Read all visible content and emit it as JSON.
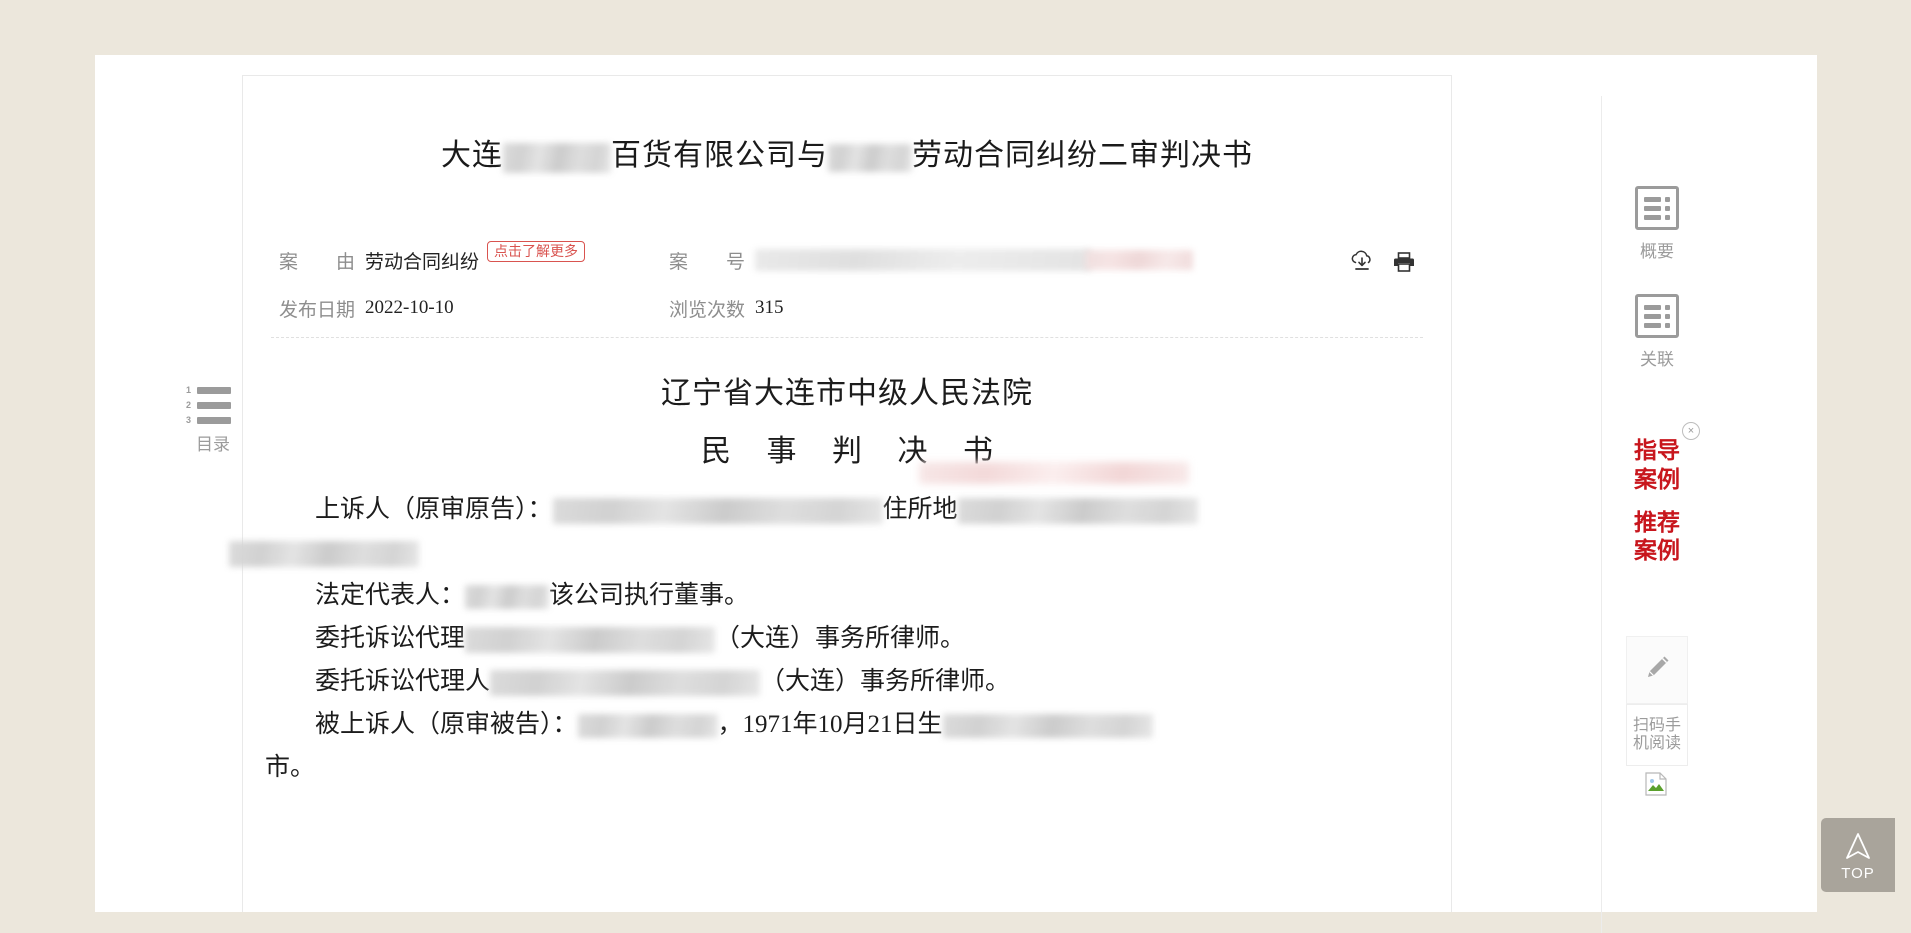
{
  "page": {
    "background_color": "#ece7dc",
    "panel_color": "#ffffff"
  },
  "document": {
    "title_prefix": "大连",
    "title_mid": "百货有限公司与",
    "title_suffix": "劳动合同纠纷二审判决书",
    "court_name": "辽宁省大连市中级人民法院",
    "doc_kind": "民 事 判 决 书"
  },
  "meta": {
    "case_cause_label": "案　　由",
    "case_cause_value": "劳动合同纠纷",
    "more_badge": "点击了解更多",
    "case_number_label": "案　　号",
    "case_number_value": "",
    "publish_date_label": "发布日期",
    "publish_date_value": "2022-10-10",
    "views_label": "浏览次数",
    "views_value": "315"
  },
  "actions": {
    "download_icon": "cloud-download-icon",
    "print_icon": "printer-icon"
  },
  "body_paragraphs": [
    {
      "id": "appellant",
      "lead": "上诉人（原审原告）：",
      "tail": "住所地",
      "redacted": true
    },
    {
      "id": "legal-rep",
      "lead": "法定代表人：",
      "tail": "该公司执行董事。",
      "redacted": true
    },
    {
      "id": "agent-1",
      "lead": "委托诉讼代理",
      "tail": "（大连）事务所律师。",
      "redacted": true
    },
    {
      "id": "agent-2",
      "lead": "委托诉讼代理人",
      "tail": "（大连）事务所律师。",
      "redacted": true
    },
    {
      "id": "appellee",
      "lead": "被上诉人（原审被告）：",
      "mid": "，1971年10月21日生",
      "tail": "市。",
      "redacted": true
    }
  ],
  "toc": {
    "label": "目录",
    "numbers": [
      "1",
      "2",
      "3"
    ],
    "icon": "numbered-list-icon"
  },
  "tools": [
    {
      "id": "summary",
      "label": "概要",
      "icon": "summary-document-icon"
    },
    {
      "id": "related",
      "label": "关联",
      "icon": "related-document-icon"
    }
  ],
  "promo": {
    "close_label": "×",
    "items": [
      {
        "id": "guiding-case",
        "line1": "指导",
        "line2": "案例",
        "color": "#c8161d"
      },
      {
        "id": "recommended-case",
        "line1": "推荐",
        "line2": "案例",
        "color": "#c8161d"
      }
    ]
  },
  "side_widgets": {
    "pencil_icon": "pencil-icon",
    "qr_text_line1": "扫码手",
    "qr_text_line2": "机阅读",
    "broken_image_icon": "broken-image-icon"
  },
  "top_button": {
    "label": "TOP",
    "icon": "arrow-up-icon",
    "color": "#a9a49b"
  }
}
